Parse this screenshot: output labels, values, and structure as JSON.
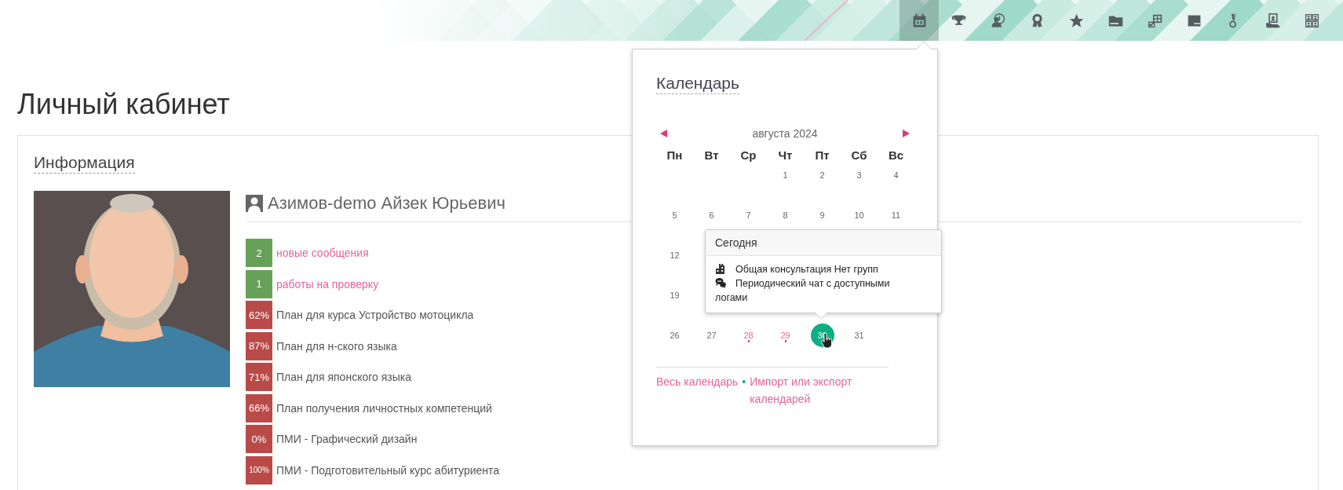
{
  "toolbar": [
    {
      "kind": "calendar",
      "selected": true
    },
    {
      "kind": "trophy",
      "selected": false
    },
    {
      "kind": "user-badge",
      "selected": false
    },
    {
      "kind": "award",
      "selected": false
    },
    {
      "kind": "star",
      "selected": false
    },
    {
      "kind": "folder",
      "selected": false
    },
    {
      "kind": "calendar-check",
      "selected": false
    },
    {
      "kind": "card",
      "selected": false
    },
    {
      "kind": "medal",
      "selected": false
    },
    {
      "kind": "portrait-hand",
      "selected": false
    },
    {
      "kind": "portrait-grid",
      "selected": false
    }
  ],
  "page": {
    "title": "Личный кабинет"
  },
  "info": {
    "heading": "Информация",
    "name": "Азимов-demo Айзек Юрьевич",
    "items": [
      {
        "count": "2",
        "label": "новые сообщения",
        "kind": "link",
        "color": "#67a159"
      },
      {
        "count": "1",
        "label": "работы на проверку",
        "kind": "link",
        "color": "#67a159"
      },
      {
        "count": "62%",
        "label": "План для курса Устройство мотоцикла",
        "kind": "plan",
        "color": "#b94a48"
      },
      {
        "count": "87%",
        "label": "План для н-ского языка",
        "kind": "plan",
        "color": "#b94a48"
      },
      {
        "count": "71%",
        "label": "План для японского языка",
        "kind": "plan",
        "color": "#b94a48"
      },
      {
        "count": "66%",
        "label": "План получения личностных компетенций",
        "kind": "plan",
        "color": "#b94a48"
      },
      {
        "count": "0%",
        "label": "ПМИ - Графический дизайн",
        "kind": "plan",
        "color": "#b94a48"
      },
      {
        "count": "100%",
        "label": "ПМИ - Подготовительный курс абитуриента",
        "kind": "plan",
        "color": "#b94a48"
      }
    ]
  },
  "calendar": {
    "title": "Календарь",
    "month": "августа 2024",
    "weekdays": [
      "Пн",
      "Вт",
      "Ср",
      "Чт",
      "Пт",
      "Сб",
      "Вс"
    ],
    "weeks": [
      [
        {
          "day": "1",
          "event": false,
          "today": false
        },
        {
          "day": "2",
          "event": false,
          "today": false
        },
        {
          "day": "3",
          "event": false,
          "today": false
        },
        {
          "day": "4",
          "event": false,
          "today": false
        }
      ],
      [
        {
          "day": "5",
          "event": false,
          "today": false
        },
        {
          "day": "6",
          "event": false,
          "today": false
        },
        {
          "day": "7",
          "event": false,
          "today": false
        },
        {
          "day": "8",
          "event": false,
          "today": false
        },
        {
          "day": "9",
          "event": false,
          "today": false
        },
        {
          "day": "10",
          "event": false,
          "today": false
        },
        {
          "day": "11",
          "event": false,
          "today": false
        }
      ],
      [
        {
          "day": "12",
          "event": false,
          "today": false
        }
      ],
      [
        {
          "day": "19",
          "event": false,
          "today": false
        }
      ],
      [
        {
          "day": "26",
          "event": false,
          "today": false
        },
        {
          "day": "27",
          "event": false,
          "today": false
        },
        {
          "day": "28",
          "event": true,
          "today": false
        },
        {
          "day": "29",
          "event": true,
          "today": false
        },
        {
          "day": "30",
          "event": false,
          "today": true
        },
        {
          "day": "31",
          "event": false,
          "today": false
        }
      ]
    ],
    "tooltip": {
      "title": "Сегодня",
      "events": [
        {
          "kind": "consultation",
          "text": "Общая консультация Нет групп"
        },
        {
          "kind": "chat",
          "text": "Периодический чат с доступными логами"
        }
      ]
    },
    "links": [
      "Весь календарь",
      "Импорт или экспорт календарей"
    ],
    "separator": "•"
  }
}
